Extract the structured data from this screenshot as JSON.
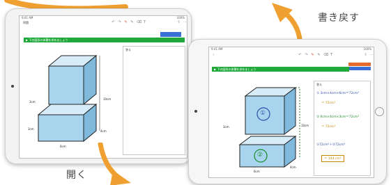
{
  "captions": {
    "write_back": "書き戻す",
    "open": "開く"
  },
  "back_ipad": {
    "status_time": "9:41 AM",
    "status_battery": "100%",
    "toolbar_tab": "問題",
    "task_banner": "▶ 下の図形の体積を求めましょう",
    "answer_label": "答え",
    "dimensions": {
      "depth_left": "3cm",
      "height_right": "10cm",
      "width_lower": "3cm",
      "depth_lower": "4cm",
      "width_bottom": "6cm"
    }
  },
  "front_ipad": {
    "status_time": "9:41 AM",
    "status_battery": "100%",
    "task_banner": "▶ 下の図形の体積を求めましょう",
    "answer_label": "答え",
    "part_labels": [
      "①",
      "②"
    ],
    "calc_lines": [
      "① 3cm×4cm×6cm＝72cm³",
      "＝ 72cm³",
      "② 6cm×4cm×3cm＝72cm³",
      "＝ 72cm³",
      "①72cm³＋②72cm³",
      "＝ 144 cm³"
    ],
    "dimensions": {
      "depth_left": "3cm",
      "height_right": "10cm",
      "width_bottom": "6cm",
      "depth_lower": "4cm"
    }
  },
  "colors": {
    "arrow": "#f0a030",
    "banner": "#1fa93b",
    "cube_face": "#a8d4ee",
    "cube_top": "#d6ecf8",
    "cube_side": "#7fb9dc"
  }
}
